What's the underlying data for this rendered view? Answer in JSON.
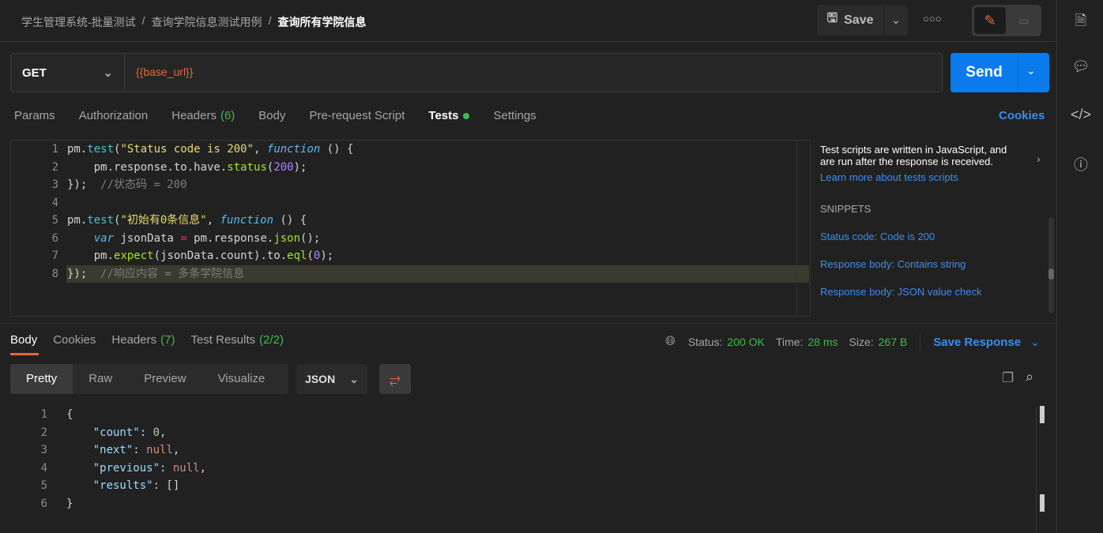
{
  "breadcrumb": [
    "学生管理系统-批量测试",
    "查询学院信息测试用例",
    "查询所有学院信息"
  ],
  "header": {
    "save_label": "Save",
    "more_icon": "ellipsis-icon"
  },
  "request": {
    "method": "GET",
    "url": "{{base_url}}",
    "send_label": "Send"
  },
  "tabs": [
    {
      "label": "Params"
    },
    {
      "label": "Authorization"
    },
    {
      "label": "Headers",
      "count": "(6)"
    },
    {
      "label": "Body"
    },
    {
      "label": "Pre-request Script"
    },
    {
      "label": "Tests",
      "active": true
    },
    {
      "label": "Settings"
    }
  ],
  "cookies_label": "Cookies",
  "editor": {
    "lines": [
      [
        [
          "k",
          "pm."
        ],
        [
          "f",
          "test"
        ],
        [
          "k",
          "("
        ],
        [
          "s",
          "\"Status code is 200\""
        ],
        [
          "k",
          ", "
        ],
        [
          "i",
          "function"
        ],
        [
          "k",
          " () {"
        ]
      ],
      [
        [
          "k",
          "    pm.response.to.have."
        ],
        [
          "m",
          "status"
        ],
        [
          "k",
          "("
        ],
        [
          "n",
          "200"
        ],
        [
          "k",
          ");"
        ]
      ],
      [
        [
          "k",
          "});  "
        ],
        [
          "c",
          "//状态码 = 200"
        ]
      ],
      [],
      [
        [
          "k",
          "pm."
        ],
        [
          "f",
          "test"
        ],
        [
          "k",
          "("
        ],
        [
          "s",
          "\"初始有0条信息\""
        ],
        [
          "k",
          ", "
        ],
        [
          "i",
          "function"
        ],
        [
          "k",
          " () {"
        ]
      ],
      [
        [
          "k",
          "    "
        ],
        [
          "i",
          "var"
        ],
        [
          "k",
          " jsonData "
        ],
        [
          "o",
          "="
        ],
        [
          "k",
          " pm.response."
        ],
        [
          "m",
          "json"
        ],
        [
          "k",
          "();"
        ]
      ],
      [
        [
          "k",
          "    pm."
        ],
        [
          "m",
          "expect"
        ],
        [
          "k",
          "(jsonData.count).to."
        ],
        [
          "m",
          "eql"
        ],
        [
          "k",
          "("
        ],
        [
          "n",
          "0"
        ],
        [
          "k",
          ");"
        ]
      ],
      [
        [
          "k",
          "});  "
        ],
        [
          "c",
          "//响应内容 = 多条学院信息"
        ]
      ]
    ]
  },
  "snippets": {
    "intro": "Test scripts are written in JavaScript, and are run after the response is received.",
    "learn_more": "Learn more about tests scripts",
    "heading": "SNIPPETS",
    "items": [
      "Status code: Code is 200",
      "Response body: Contains string",
      "Response body: JSON value check"
    ]
  },
  "response": {
    "tabs": [
      {
        "label": "Body",
        "active": true
      },
      {
        "label": "Cookies"
      },
      {
        "label": "Headers",
        "count": "(7)"
      },
      {
        "label": "Test Results",
        "count": "(2/2)"
      }
    ],
    "status_label": "Status:",
    "status": "200 OK",
    "time_label": "Time:",
    "time": "28 ms",
    "size_label": "Size:",
    "size": "267 B",
    "save_response": "Save Response",
    "views": [
      "Pretty",
      "Raw",
      "Preview",
      "Visualize"
    ],
    "format": "JSON",
    "body": [
      [
        [
          "p",
          "{"
        ]
      ],
      [
        [
          "p",
          "    "
        ],
        [
          "key",
          "\"count\""
        ],
        [
          "p",
          ": "
        ],
        [
          "num",
          "0"
        ],
        [
          "p",
          ","
        ]
      ],
      [
        [
          "p",
          "    "
        ],
        [
          "key",
          "\"next\""
        ],
        [
          "p",
          ": "
        ],
        [
          "null",
          "null"
        ],
        [
          "p",
          ","
        ]
      ],
      [
        [
          "p",
          "    "
        ],
        [
          "key",
          "\"previous\""
        ],
        [
          "p",
          ": "
        ],
        [
          "null",
          "null"
        ],
        [
          "p",
          ","
        ]
      ],
      [
        [
          "p",
          "    "
        ],
        [
          "key",
          "\"results\""
        ],
        [
          "p",
          ": []"
        ]
      ],
      [
        [
          "p",
          "}"
        ]
      ]
    ]
  },
  "colors": {
    "accent": "#0d7ee8",
    "send": "#097bed",
    "success": "#3fb950",
    "link": "#3b8eea",
    "active_tab": "#e8663d"
  }
}
